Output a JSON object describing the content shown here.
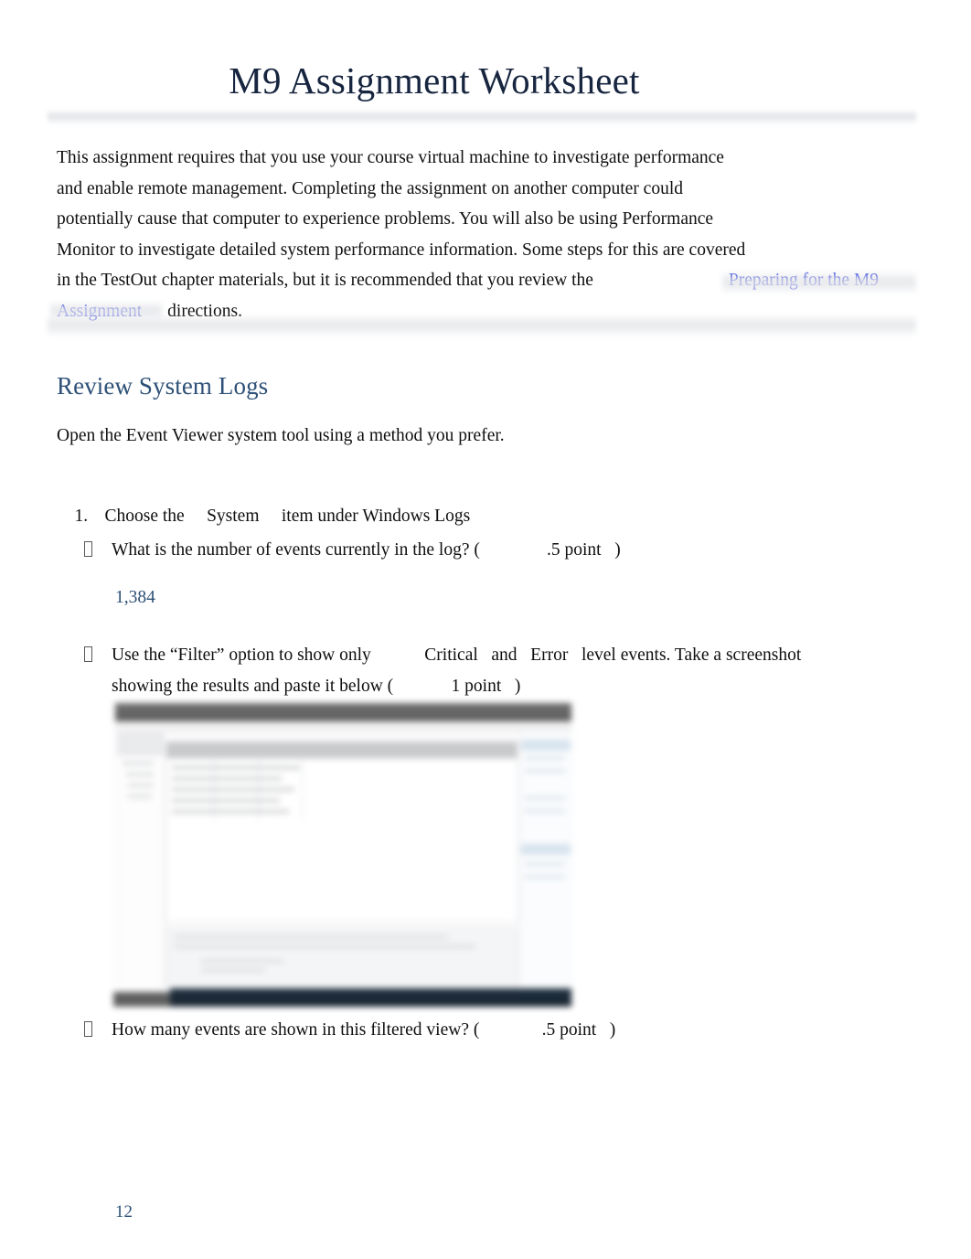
{
  "document": {
    "title": "M9 Assignment Worksheet",
    "page_number": "12"
  },
  "intro": {
    "line1": "This assignment requires that you use your course virtual machine to investigate performance",
    "line2": "and enable remote management. Completing the assignment on another computer could",
    "line3": "potentially cause that computer to experience problems. You will also be using Performance",
    "line4": "Monitor to investigate detailed system performance information. Some steps for this are covered",
    "line5_before": "in the TestOut chapter materials, but it is recommended that you review the",
    "link_part1": "Preparing for the M9",
    "link_part2": "Assignment",
    "line6_after": "directions."
  },
  "section": {
    "heading": "Review System Logs",
    "open_instruction": "Open the Event Viewer system tool using a method you prefer."
  },
  "steps": [
    {
      "number": "1.",
      "text": "Choose the     System     item under Windows Logs"
    }
  ],
  "bullets": {
    "b1": {
      "text": "What is the number of events currently in the log? (               .5 point   )",
      "answer": "1,384"
    },
    "b2": {
      "line1": "Use the “Filter” option to show only            Critical   and   Error   level events. Take a screenshot",
      "line2": "showing the results and paste it below (             1 point   )"
    },
    "b3": {
      "text": "How many events are shown in this filtered view? (              .5 point   )"
    }
  },
  "embedded_screenshot": {
    "alt": "Blurred screenshot of Windows Event Viewer with filtered results"
  },
  "colors": {
    "title": "#17253f",
    "heading": "#2e5077",
    "link": "#2a2ae8",
    "answer": "#2e5077",
    "body": "#0f0f0f"
  },
  "icons": {
    "bullet": "tofu-box-bullet-icon"
  }
}
